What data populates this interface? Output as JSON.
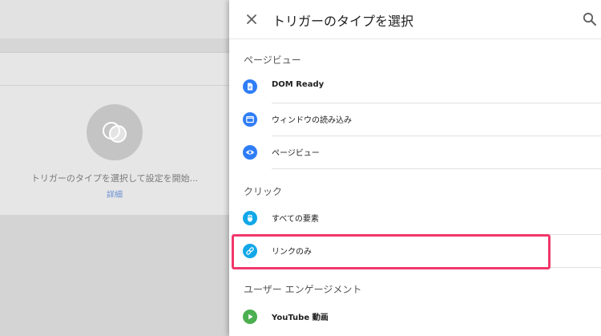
{
  "background": {
    "placeholder_text": "トリガーのタイプを選択して設定を開始...",
    "details_link": "詳細"
  },
  "panel": {
    "title": "トリガーのタイプを選択",
    "close_icon": "close-icon",
    "search_icon": "search-icon",
    "sections": [
      {
        "label": "ページビュー",
        "items": [
          {
            "label": "DOM Ready",
            "icon": "document-icon",
            "color": "#2f7df6",
            "bold": true
          },
          {
            "label": "ウィンドウの読み込み",
            "icon": "window-icon",
            "color": "#2f7df6",
            "bold": false
          },
          {
            "label": "ページビュー",
            "icon": "eye-icon",
            "color": "#2f7df6",
            "bold": false
          }
        ]
      },
      {
        "label": "クリック",
        "items": [
          {
            "label": "すべての要素",
            "icon": "mouse-icon",
            "color": "#12a8e8",
            "bold": false
          },
          {
            "label": "リンクのみ",
            "icon": "link-icon",
            "color": "#12a8e8",
            "bold": false
          }
        ]
      },
      {
        "label": "ユーザー エンゲージメント",
        "items": [
          {
            "label": "YouTube 動画",
            "icon": "play-icon",
            "color": "#4caf50",
            "bold": true
          }
        ]
      }
    ]
  },
  "colors": {
    "highlight": "#f0386b",
    "link": "#6b8fd3"
  }
}
